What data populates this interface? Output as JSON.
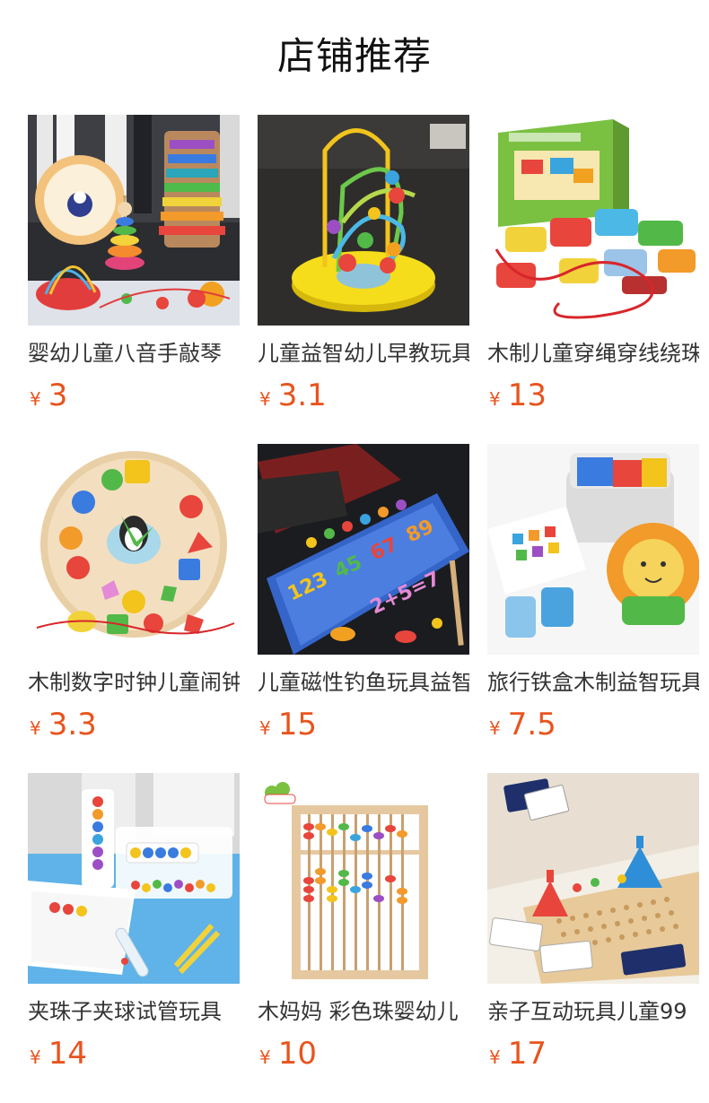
{
  "section_title": "店铺推荐",
  "currency_symbol": "¥",
  "products": [
    {
      "name": "婴幼儿童八音手敲琴",
      "price": "3",
      "image": "xylophone-toy-set-photo"
    },
    {
      "name": "儿童益智幼儿早教玩具",
      "price": "3.1",
      "image": "bead-maze-toy-photo"
    },
    {
      "name": "木制儿童穿绳穿线绕珠",
      "price": "13",
      "image": "lacing-blocks-toy-photo"
    },
    {
      "name": "木制数字时钟儿童闹钟",
      "price": "3.3",
      "image": "wooden-clock-toy-photo"
    },
    {
      "name": "儿童磁性钓鱼玩具益智",
      "price": "15",
      "image": "magnetic-fishing-board-photo"
    },
    {
      "name": "旅行铁盒木制益智玩具",
      "price": "7.5",
      "image": "travel-tin-puzzle-photo"
    },
    {
      "name": "夹珠子夹球试管玩具",
      "price": "14",
      "image": "bead-tweezer-tube-toy-photo"
    },
    {
      "name": "木妈妈 彩色珠婴幼儿",
      "price": "10",
      "image": "wooden-abacus-photo"
    },
    {
      "name": "亲子互动玩具儿童99",
      "price": "17",
      "image": "parent-child-board-game-photo"
    }
  ]
}
